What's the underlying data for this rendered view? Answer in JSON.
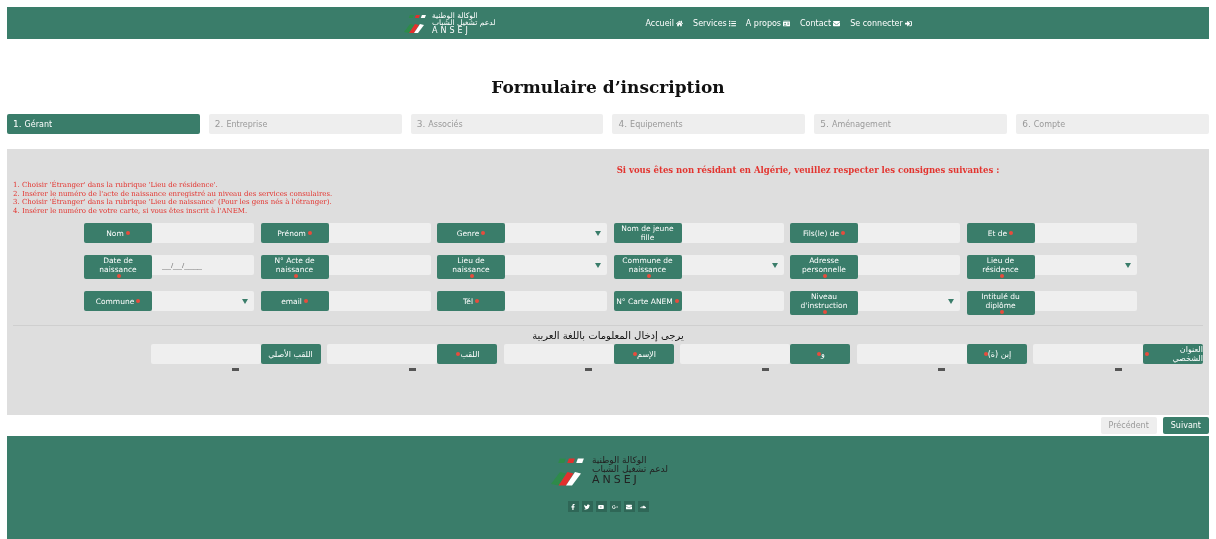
{
  "header": {
    "logo": {
      "arabic_line_1": "الوكالة الوطنية",
      "arabic_line_2": "لدعم تشغيل الشباب",
      "name": "ANSEJ"
    },
    "nav": [
      {
        "label": "Accueil"
      },
      {
        "label": "Services"
      },
      {
        "label": "A propos"
      },
      {
        "label": "Contact"
      },
      {
        "label": "Se connecter"
      }
    ]
  },
  "title": "Formulaire d’inscription",
  "steps": [
    {
      "number": "1.",
      "label": "Gérant",
      "selected": true
    },
    {
      "number": "2.",
      "label": "Entreprise",
      "selected": false
    },
    {
      "number": "3.",
      "label": "Associés",
      "selected": false
    },
    {
      "number": "4.",
      "label": "Equipements",
      "selected": false
    },
    {
      "number": "5.",
      "label": "Aménagement",
      "selected": false
    },
    {
      "number": "6.",
      "label": "Compte",
      "selected": false
    }
  ],
  "notice": {
    "heading": "Si vous êtes non résidant en Algérie, veuillez respecter les consignes suivantes :",
    "items": [
      {
        "number": "1.",
        "text": "Choisir 'Étranger' dans la rubrique 'Lieu de résidence'."
      },
      {
        "number": "2.",
        "text": "Insérer le numéro de l'acte de naissance enregistré au niveau des services consulaires."
      },
      {
        "number": "3.",
        "text": "Choisir 'Étranger' dans la rubrique 'Lieu de naissance' (Pour les gens nés à l'étranger)."
      },
      {
        "number": "4.",
        "text": "Insérer le numéro de votre carte, si vous êtes inscrit à l'ANEM."
      }
    ]
  },
  "fields": [
    {
      "label": "Nom",
      "kind": "text",
      "required": true
    },
    {
      "label": "Prénom",
      "kind": "text",
      "required": true
    },
    {
      "label": "Genre",
      "kind": "select",
      "required": true
    },
    {
      "label": "Nom de jeune fille",
      "kind": "text",
      "required": false
    },
    {
      "label": "Fils(le) de",
      "kind": "text",
      "required": true
    },
    {
      "label": "Et de",
      "kind": "text",
      "required": true
    },
    {
      "label": "Date de naissance",
      "kind": "text",
      "required": true,
      "placeholder": "__/__/____"
    },
    {
      "label": "N° Acte de naissance",
      "kind": "text",
      "required": true
    },
    {
      "label": "Lieu de naissance",
      "kind": "select",
      "required": true
    },
    {
      "label": "Commune de naissance",
      "kind": "select",
      "required": true
    },
    {
      "label": "Adresse personnelle",
      "kind": "text",
      "required": true
    },
    {
      "label": "Lieu de résidence",
      "kind": "select",
      "required": true
    },
    {
      "label": "Commune",
      "kind": "select",
      "required": true
    },
    {
      "label": "email",
      "kind": "text",
      "required": true
    },
    {
      "label": "Tél",
      "kind": "text",
      "required": true
    },
    {
      "label": "N° Carte ANEM",
      "kind": "text",
      "required": true
    },
    {
      "label": "Niveau d'instruction",
      "kind": "select",
      "required": true
    },
    {
      "label": "Intitulé du diplôme",
      "kind": "text",
      "required": true
    }
  ],
  "arabic_section": {
    "heading": "يرجى إدخال المعلومات باللغة العربية",
    "fields": [
      {
        "label": "العنوان الشخصي",
        "required": true
      },
      {
        "label": "إبن (ة)",
        "required": true
      },
      {
        "label": "و",
        "required": true
      },
      {
        "label": "الإسم",
        "required": true
      },
      {
        "label": "اللقب",
        "required": true
      },
      {
        "label": "اللقب الأصلي",
        "required": false
      }
    ]
  },
  "buttons": [
    {
      "label": "Précédent",
      "disabled": true
    },
    {
      "label": "Suivant",
      "disabled": false
    }
  ],
  "footer": {
    "logo": {
      "arabic_line_1": "الوكالة الوطنية",
      "arabic_line_2": "لدعم تشغيل الشباب",
      "name": "ANSEJ"
    }
  }
}
